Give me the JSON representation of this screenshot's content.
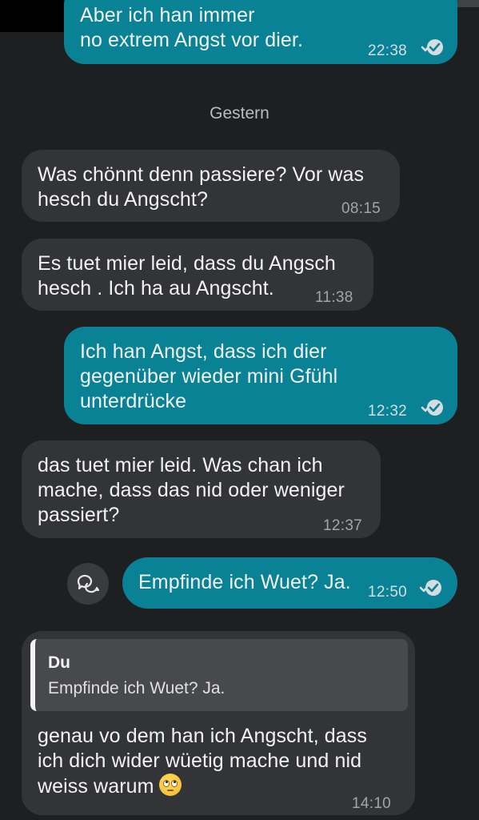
{
  "messages": {
    "m0": {
      "text": "Aber ich han immer\nno extrem Angst vor dier.",
      "time": "22:38"
    },
    "date_separator": "Gestern",
    "m1": {
      "text": "Was chönnt denn passiere? Vor was\nhesch du Angscht?",
      "time": "08:15"
    },
    "m2": {
      "text": "Es tuet mier leid, dass du Angsch\nhesch . Ich ha au Angscht.",
      "time": "11:38"
    },
    "m3": {
      "text": "Ich han Angst, dass ich dier\ngegenüber wieder mini Gfühl\nunterdrücke",
      "time": "12:32"
    },
    "m4": {
      "text": "das tuet mier leid. Was chan ich\nmache, dass das nid oder weniger\npassiert?",
      "time": "12:37"
    },
    "m5": {
      "text": "Empfinde ich Wuet? Ja.",
      "time": "12:50"
    },
    "m6": {
      "quote_author": "Du",
      "quote_text": "Empfinde ich Wuet? Ja.",
      "text": "genau vo dem han ich Angscht, dass\nich dich wider wüetig mache und nid\nweiss warum",
      "time": "14:10"
    }
  },
  "icons": {
    "read_receipt": "double-check-icon",
    "reply_action": "chat-bubbles-icon",
    "emoji": "face-with-rolling-eyes-emoji"
  },
  "colors": {
    "background": "#1e1f21",
    "outgoing_bubble": "#0a8295",
    "incoming_bubble": "#333437"
  }
}
